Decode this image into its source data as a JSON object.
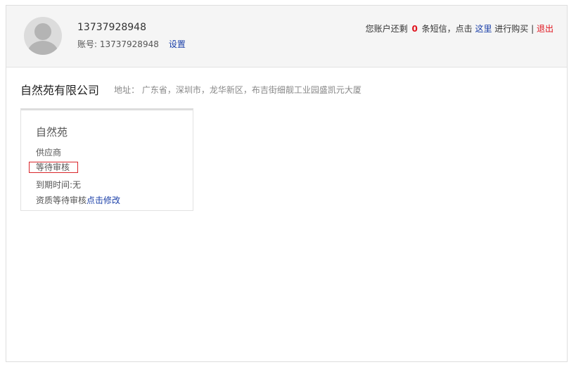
{
  "header": {
    "phone": "13737928948",
    "account_label": "账号: ",
    "account_value": "13737928948",
    "settings_link": "设置",
    "sms_prefix": "您账户还剩 ",
    "sms_count": "0",
    "sms_middle": " 条短信，点击 ",
    "sms_here_link": "这里",
    "sms_suffix": " 进行购买 | ",
    "logout_link": "退出"
  },
  "company": {
    "name": "自然苑有限公司",
    "address": "地址： 广东省，深圳市，龙华新区，布吉街细靓工业园盛凯元大厦"
  },
  "card": {
    "title": "自然苑",
    "type": "供应商",
    "status": "等待审核",
    "expire": "到期时间:无",
    "qual_text": "资质等待审核",
    "qual_link": "点击修改"
  },
  "colors": {
    "link_blue": "#1a3fa8",
    "alert_red": "#e0141e",
    "status_border": "#d9262b",
    "header_bg": "#f5f5f5"
  },
  "icons": {
    "avatar": "default-user-avatar-icon"
  }
}
